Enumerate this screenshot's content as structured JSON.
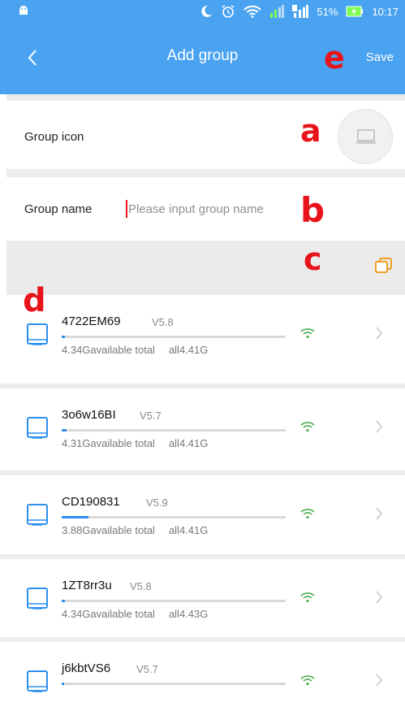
{
  "status_bar": {
    "battery_percent": "51%",
    "time": "10:17",
    "icons": [
      "android-icon",
      "moon-icon",
      "alarm-icon",
      "wifi-icon",
      "signal-icon",
      "signal-2-icon",
      "battery-charging-icon"
    ]
  },
  "header": {
    "back_icon": "back-arrow-icon",
    "title": "Add group",
    "save_label": "Save"
  },
  "annotations": {
    "a": "a",
    "b": "b",
    "c": "c",
    "d": "d",
    "e": "e"
  },
  "group_icon": {
    "label": "Group icon",
    "icon": "monitor-icon"
  },
  "group_name": {
    "label": "Group name",
    "placeholder": "Please input group name",
    "value": ""
  },
  "select_all_icon": "copy-icon",
  "colors": {
    "accent": "#4aa3f0",
    "annotation": "#e8141c",
    "progress": "#2d8ff0",
    "wifi": "#4caf50",
    "select_icon": "#f0a020"
  },
  "devices": [
    {
      "name": "4722EM69",
      "version": "V5.8",
      "available": "4.34Gavailable",
      "total_label": "total",
      "total": "all4.41G",
      "usage": 0.016
    },
    {
      "name": "3o6w16BI",
      "version": "V5.7",
      "available": "4.31Gavailable",
      "total_label": "total",
      "total": "all4.41G",
      "usage": 0.022
    },
    {
      "name": "CD190831",
      "version": "V5.9",
      "available": "3.88Gavailable",
      "total_label": "total",
      "total": "all4.41G",
      "usage": 0.12
    },
    {
      "name": "1ZT8rr3u",
      "version": "V5.8",
      "available": "4.34Gavailable",
      "total_label": "total",
      "total": "all4.43G",
      "usage": 0.016
    },
    {
      "name": "j6kbtVS6",
      "version": "V5.7",
      "available": "",
      "total_label": "",
      "total": "",
      "usage": 0.012
    }
  ]
}
